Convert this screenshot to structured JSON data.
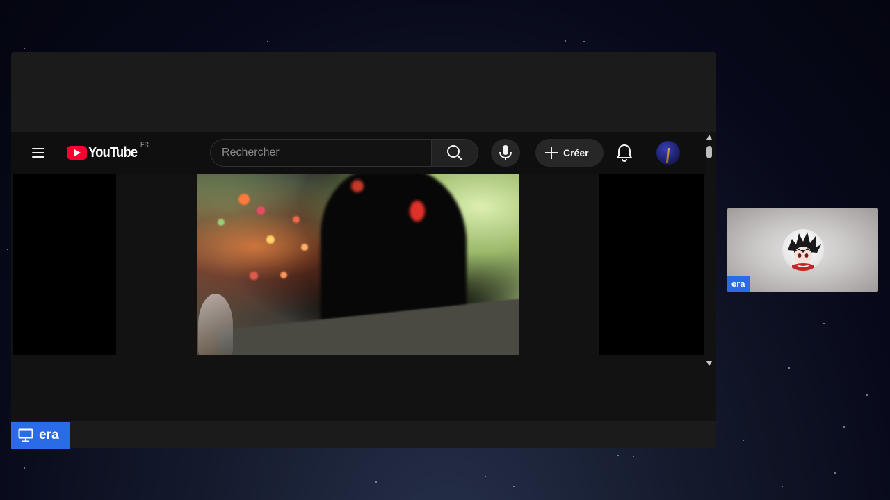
{
  "youtube": {
    "logo_text": "YouTube",
    "country_code": "FR",
    "search_placeholder": "Rechercher",
    "create_label": "Créer",
    "icons": {
      "menu": "hamburger-menu-icon",
      "search": "search-icon",
      "mic": "microphone-icon",
      "create": "plus-icon",
      "notifications": "bell-icon"
    },
    "brand_color": "#ff0033"
  },
  "presenter": {
    "name": "era",
    "icon": "monitor-icon"
  },
  "participant": {
    "name": "era"
  },
  "colors": {
    "name_tag": "#2a6ce8",
    "background": "#07091a"
  }
}
